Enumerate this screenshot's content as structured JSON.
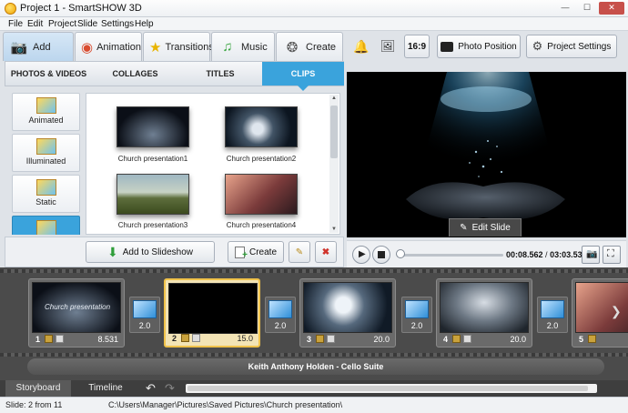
{
  "window": {
    "title": "Project 1 - SmartSHOW 3D"
  },
  "menu": [
    "File",
    "Edit",
    "Project",
    "Slide",
    "Settings",
    "Help"
  ],
  "main_tabs": [
    {
      "label": "Add",
      "icon": "add-photo-icon"
    },
    {
      "label": "Animation",
      "icon": "palette-icon"
    },
    {
      "label": "Transitions",
      "icon": "star-icon"
    },
    {
      "label": "Music",
      "icon": "music-note-icon"
    },
    {
      "label": "Create",
      "icon": "film-reel-icon"
    }
  ],
  "right_toolbar": {
    "aspect_label": "16:9",
    "photo_position_label": "Photo Position",
    "project_settings_label": "Project Settings"
  },
  "sub_tabs": [
    "PHOTOS & VIDEOS",
    "COLLAGES",
    "TITLES",
    "CLIPS"
  ],
  "categories": [
    {
      "label": "Animated"
    },
    {
      "label": "Illuminated"
    },
    {
      "label": "Static"
    },
    {
      "label": ""
    }
  ],
  "clips": [
    {
      "label": "Church presentation1"
    },
    {
      "label": "Church presentation2"
    },
    {
      "label": "Church presentation3"
    },
    {
      "label": "Church presentation4"
    }
  ],
  "actions": {
    "add_label": "Add to Slideshow",
    "create_label": "Create"
  },
  "preview": {
    "edit_label": "Edit Slide"
  },
  "player": {
    "current_time": "00:08.562",
    "separator": " / ",
    "total_time": "03:03.531",
    "progress": 0.0
  },
  "slides": [
    {
      "num": "1",
      "duration": "8.531",
      "thumb_text": "Church presentation"
    },
    {
      "num": "2",
      "duration": "15.0",
      "thumb_text": ""
    },
    {
      "num": "3",
      "duration": "20.0",
      "thumb_text": ""
    },
    {
      "num": "4",
      "duration": "20.0",
      "thumb_text": ""
    },
    {
      "num": "5",
      "duration": "",
      "thumb_text": ""
    }
  ],
  "transitions": [
    {
      "duration": "2.0"
    },
    {
      "duration": "2.0"
    },
    {
      "duration": "2.0"
    },
    {
      "duration": "2.0"
    }
  ],
  "music_track": "Keith Anthony Holden - Cello Suite",
  "view_tabs": [
    "Storyboard",
    "Timeline"
  ],
  "status": {
    "slide_info": "Slide: 2 from 11",
    "path": "C:\\Users\\Manager\\Pictures\\Saved Pictures\\Church presentation\\"
  },
  "colors": {
    "accent": "#3aa3dc",
    "active_slide_border": "#f0c24a",
    "storyboard_bg": "#4b4b4b"
  }
}
